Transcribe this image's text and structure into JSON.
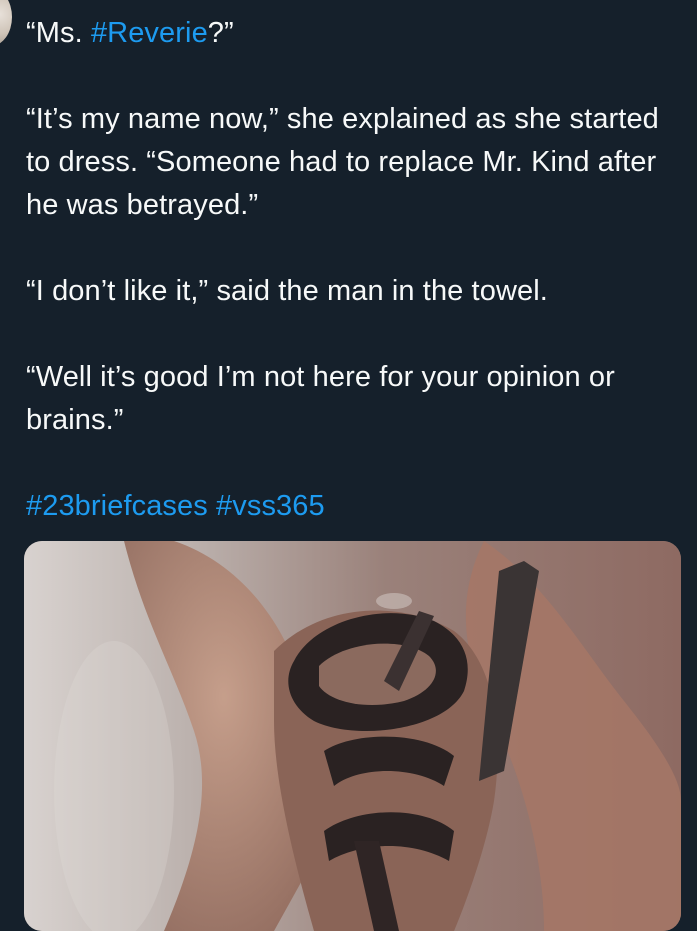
{
  "tweet": {
    "line1_prefix": "“Ms. ",
    "line1_hashtag": "#Reverie",
    "line1_suffix": "?”",
    "para2": "“It’s my name now,” she explained as she started to dress. “Someone had to replace Mr. Kind after he was betrayed.”",
    "para3": "“I don’t like it,” said the man in the towel.",
    "para4": "“Well it’s good I’m not here for your opinion or brains.”",
    "hashtags": [
      "#23briefcases",
      "#vss365"
    ]
  },
  "media": {
    "type": "photo"
  }
}
